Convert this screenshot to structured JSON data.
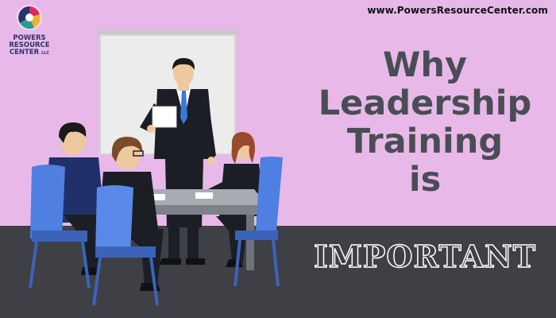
{
  "website_url": "www.PowersResourceCenter.com",
  "logo": {
    "line1": "POWERS",
    "line2": "RESOURCE",
    "line3": "CENTER",
    "suffix": "LLC",
    "colors": [
      "#e0285a",
      "#2a9d8f",
      "#f2b134",
      "#2a3370"
    ]
  },
  "headline": {
    "line1": "Why",
    "line2": "Leadership",
    "line3": "Training",
    "line4": "is",
    "emphasis": "IMPORTANT"
  },
  "colors": {
    "background": "#e8b9e8",
    "floor": "#3f4046",
    "headline_text": "#4a4d55",
    "chair": "#4f7fe0",
    "suit": "#1c1e26",
    "table": "#9da1a8"
  }
}
